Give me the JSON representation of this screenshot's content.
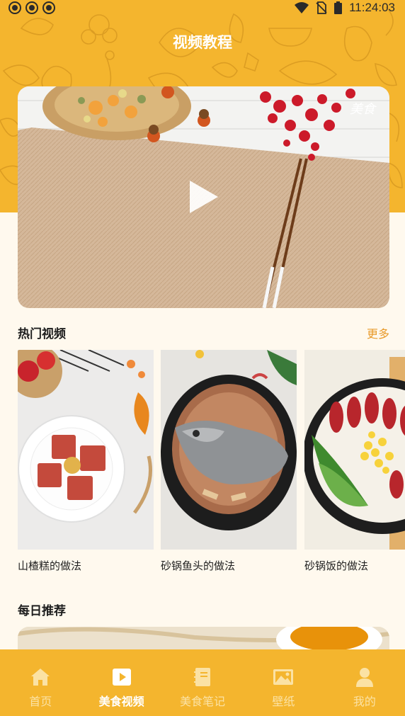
{
  "status_bar": {
    "time": "11:24:03",
    "icons": [
      "notification-icon",
      "notification-icon",
      "notification-icon",
      "wifi-icon",
      "no-sim-icon",
      "battery-icon"
    ]
  },
  "header": {
    "title": "视频教程",
    "background_color": "#F4B52E"
  },
  "hero_video": {
    "watermark": "美食",
    "play_icon": "play-icon"
  },
  "hot_videos": {
    "title": "热门视频",
    "more_label": "更多",
    "items": [
      {
        "label": "山楂糕的做法"
      },
      {
        "label": "砂锅鱼头的做法"
      },
      {
        "label": "砂锅饭的做法"
      }
    ]
  },
  "daily": {
    "title": "每日推荐"
  },
  "tabbar": {
    "active_color": "#ffffff",
    "inactive_color": "#FBE2A4",
    "items": [
      {
        "label": "首页",
        "icon": "home-icon",
        "active": false
      },
      {
        "label": "美食视频",
        "icon": "video-icon",
        "active": true
      },
      {
        "label": "美食笔记",
        "icon": "notebook-icon",
        "active": false
      },
      {
        "label": "壁纸",
        "icon": "image-icon",
        "active": false
      },
      {
        "label": "我的",
        "icon": "user-icon",
        "active": false
      }
    ]
  }
}
